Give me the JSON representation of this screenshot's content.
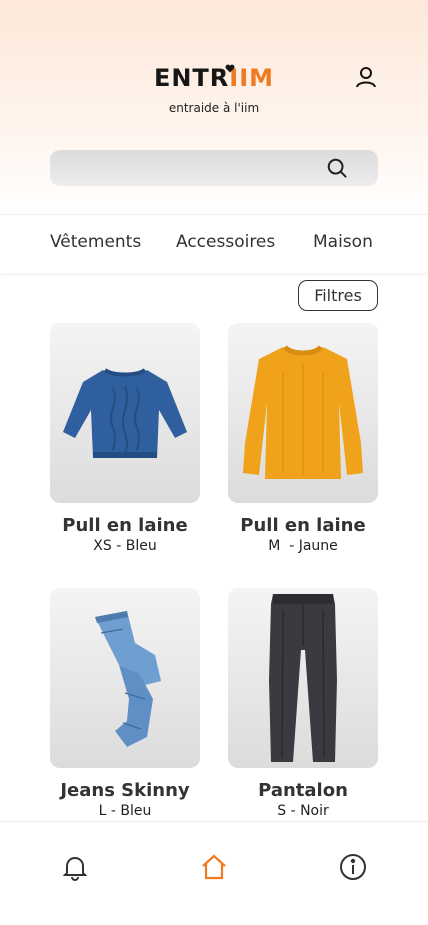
{
  "brand": {
    "name_main": "ENTR",
    "name_accent": "IIM",
    "tagline": "entraide à l'iim",
    "accent_color": "#ee7b22"
  },
  "header": {
    "user_icon": "user-icon"
  },
  "search": {
    "value": "",
    "placeholder": "",
    "icon": "search-icon"
  },
  "categories": [
    "Vêtements",
    "Accessoires",
    "Maison"
  ],
  "filters_label": "Filtres",
  "products": [
    {
      "title": "Pull en laine",
      "subtitle": "XS - Bleu",
      "image": "blue-sweater",
      "color": "#2f5f9e"
    },
    {
      "title": "Pull en laine",
      "subtitle": "M  - Jaune",
      "image": "yellow-sweater",
      "color": "#f0a21b"
    },
    {
      "title": "Jeans Skinny",
      "subtitle": "L - Bleu",
      "image": "jeans",
      "color": "#6f9fd0"
    },
    {
      "title": "Pantalon",
      "subtitle": "S - Noir",
      "image": "trousers",
      "color": "#3a3b40"
    }
  ],
  "bottom_nav": [
    {
      "name": "notifications",
      "icon": "bell-icon",
      "active": false
    },
    {
      "name": "home",
      "icon": "home-icon",
      "active": true
    },
    {
      "name": "info",
      "icon": "info-icon",
      "active": false
    }
  ]
}
